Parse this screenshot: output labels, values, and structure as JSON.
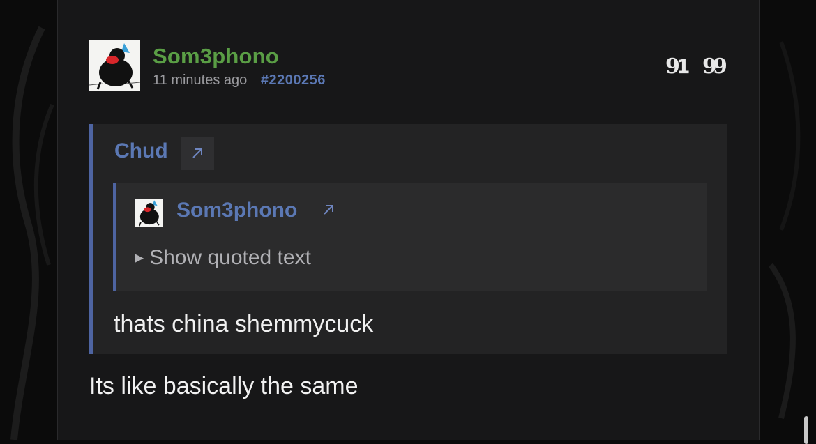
{
  "post": {
    "username": "Som3phono",
    "time": "11 minutes ago",
    "post_id": "#2200256",
    "body": "Its like basically the same"
  },
  "actions": {
    "reply_icon": "reply-quote-icon",
    "quote_icon": "quote-icon"
  },
  "quote": {
    "author": "Chud",
    "link_icon": "external-link-arrow-icon",
    "text": "thats china shemmycuck",
    "nested": {
      "author": "Som3phono",
      "show_label": "Show quoted text",
      "toggle_icon": "triangle-right-icon"
    }
  },
  "colors": {
    "username": "#5a9e45",
    "link": "#5b78b4",
    "quote_border": "#4e64a1",
    "panel_bg": "#171718",
    "quote_bg": "#232324",
    "nested_bg": "#2b2b2c"
  }
}
